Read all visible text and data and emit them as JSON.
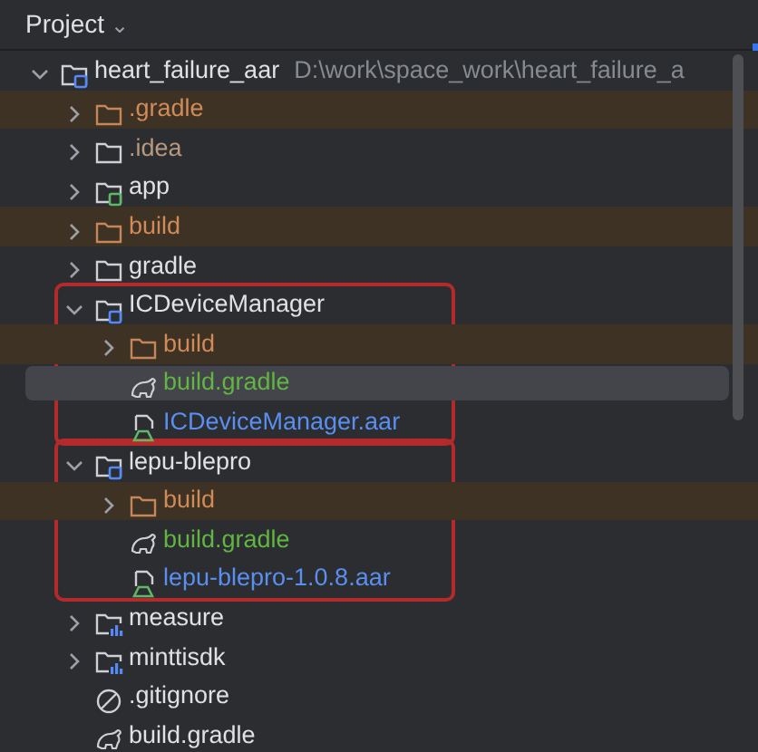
{
  "panel": {
    "title": "Project",
    "dropdown": "⌄"
  },
  "tree": [
    {
      "label": "heart_failure_aar",
      "path": "D:\\work\\space_work\\heart_failure_a",
      "kind": "module",
      "color": "#dfe1e5",
      "excluded": false,
      "expanded": true,
      "selected": false,
      "children": [
        {
          "label": ".gradle",
          "kind": "folder",
          "color": "#d18b58",
          "excluded": true,
          "expanded": false,
          "selected": false
        },
        {
          "label": ".idea",
          "kind": "folder",
          "color": "#b8997c",
          "excluded": false,
          "expanded": false,
          "selected": false
        },
        {
          "label": "app",
          "kind": "app-module",
          "color": "#dfe1e5",
          "excluded": false,
          "expanded": false,
          "selected": false
        },
        {
          "label": "build",
          "kind": "folder",
          "color": "#d18b58",
          "excluded": true,
          "expanded": false,
          "selected": false
        },
        {
          "label": "gradle",
          "kind": "folder",
          "color": "#dfe1e5",
          "excluded": false,
          "expanded": false,
          "selected": false
        },
        {
          "label": "ICDeviceManager",
          "kind": "module",
          "color": "#dfe1e5",
          "excluded": false,
          "expanded": true,
          "selected": false,
          "annotated": true,
          "children": [
            {
              "label": "build",
              "kind": "folder",
              "color": "#d18b58",
              "excluded": true,
              "expanded": false,
              "selected": false
            },
            {
              "label": "build.gradle",
              "kind": "gradle",
              "color": "#62b543",
              "excluded": false,
              "selected": true
            },
            {
              "label": "ICDeviceManager.aar",
              "kind": "archive",
              "color": "#5a8ff0",
              "excluded": false,
              "selected": false
            }
          ]
        },
        {
          "label": "lepu-blepro",
          "kind": "module",
          "color": "#dfe1e5",
          "excluded": false,
          "expanded": true,
          "selected": false,
          "annotated": true,
          "children": [
            {
              "label": "build",
              "kind": "folder",
              "color": "#d18b58",
              "excluded": true,
              "expanded": false,
              "selected": false
            },
            {
              "label": "build.gradle",
              "kind": "gradle",
              "color": "#62b543",
              "excluded": false,
              "selected": false
            },
            {
              "label": "lepu-blepro-1.0.8.aar",
              "kind": "archive",
              "color": "#5a8ff0",
              "excluded": false,
              "selected": false
            }
          ]
        },
        {
          "label": "measure",
          "kind": "library-module",
          "color": "#dfe1e5",
          "excluded": false,
          "expanded": false,
          "selected": false
        },
        {
          "label": "minttisdk",
          "kind": "library-module",
          "color": "#dfe1e5",
          "excluded": false,
          "expanded": false,
          "selected": false
        },
        {
          "label": ".gitignore",
          "kind": "ignore-file",
          "color": "#dfe1e5",
          "excluded": false,
          "selected": false
        },
        {
          "label": "build.gradle",
          "kind": "gradle",
          "color": "#dfe1e5",
          "excluded": false,
          "selected": false
        }
      ]
    }
  ]
}
